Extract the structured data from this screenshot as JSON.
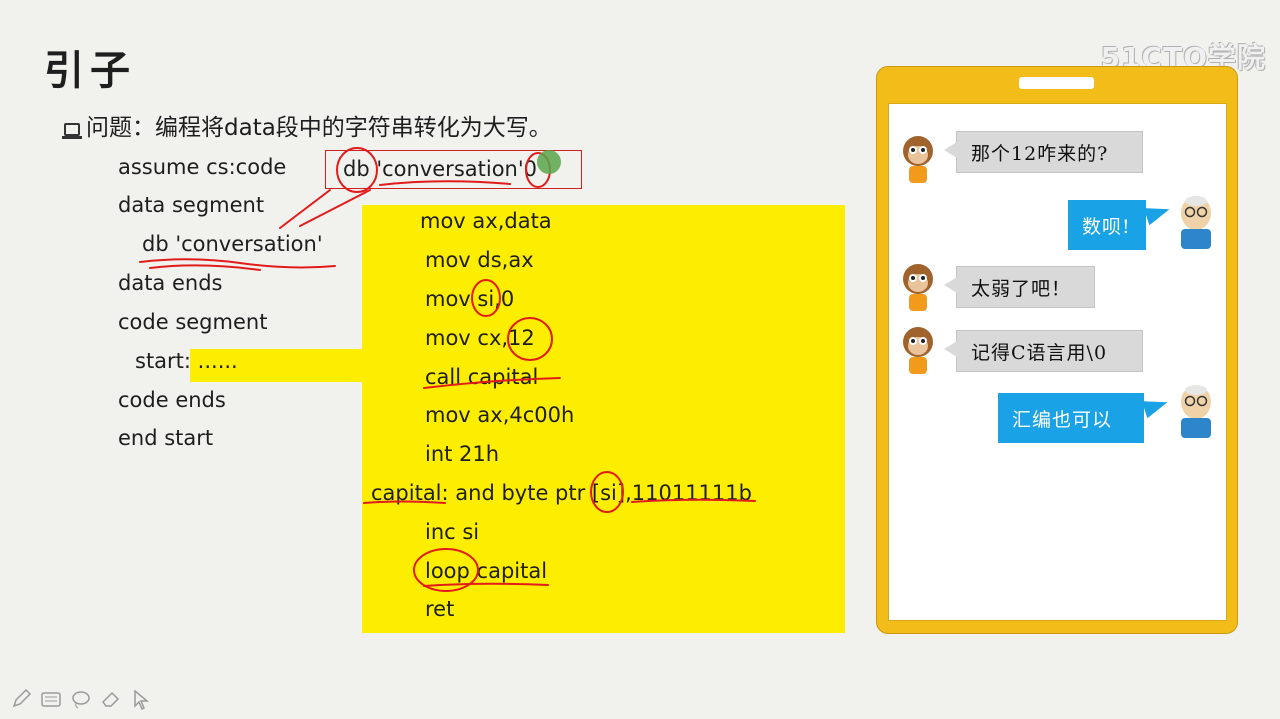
{
  "slide": {
    "title": "引子",
    "question": "问题：编程将data段中的字符串转化为大写。",
    "brand": "51CTO学院"
  },
  "code_left": [
    "assume cs:code",
    "data segment",
    "db 'conversation'",
    "data ends",
    "code segment",
    "start: ......",
    "code ends",
    "end start"
  ],
  "db_annotation": {
    "db": "db",
    "str": "'conversation'",
    "zero": "0"
  },
  "code_right": [
    "mov ax,data",
    "mov ds,ax",
    "mov si,0",
    "mov cx,12",
    "call capital",
    "mov ax,4c00h",
    "int 21h",
    "capital: and byte ptr [si],11011111b",
    "inc si",
    "loop capital",
    "ret"
  ],
  "chat": [
    {
      "side": "left",
      "text": "那个12咋来的?",
      "avatar": "monkey-avatar"
    },
    {
      "side": "right",
      "text": "数呗!",
      "avatar": "old-man-avatar"
    },
    {
      "side": "left",
      "text": "太弱了吧！",
      "avatar": "monkey-avatar"
    },
    {
      "side": "left",
      "text": "记得C语言用\\0",
      "avatar": "monkey-avatar"
    },
    {
      "side": "right",
      "text": "汇编也可以",
      "avatar": "old-man-avatar"
    }
  ],
  "colors": {
    "highlight": "#fdee00",
    "phone": "#f2bd18",
    "bubble_gray": "#d9d9d9",
    "bubble_blue": "#1aa2e6",
    "ink": "#e21b1b"
  },
  "toolbar": [
    "pen-icon",
    "keyboard-icon",
    "lasso-icon",
    "eraser-icon",
    "pointer-icon"
  ]
}
